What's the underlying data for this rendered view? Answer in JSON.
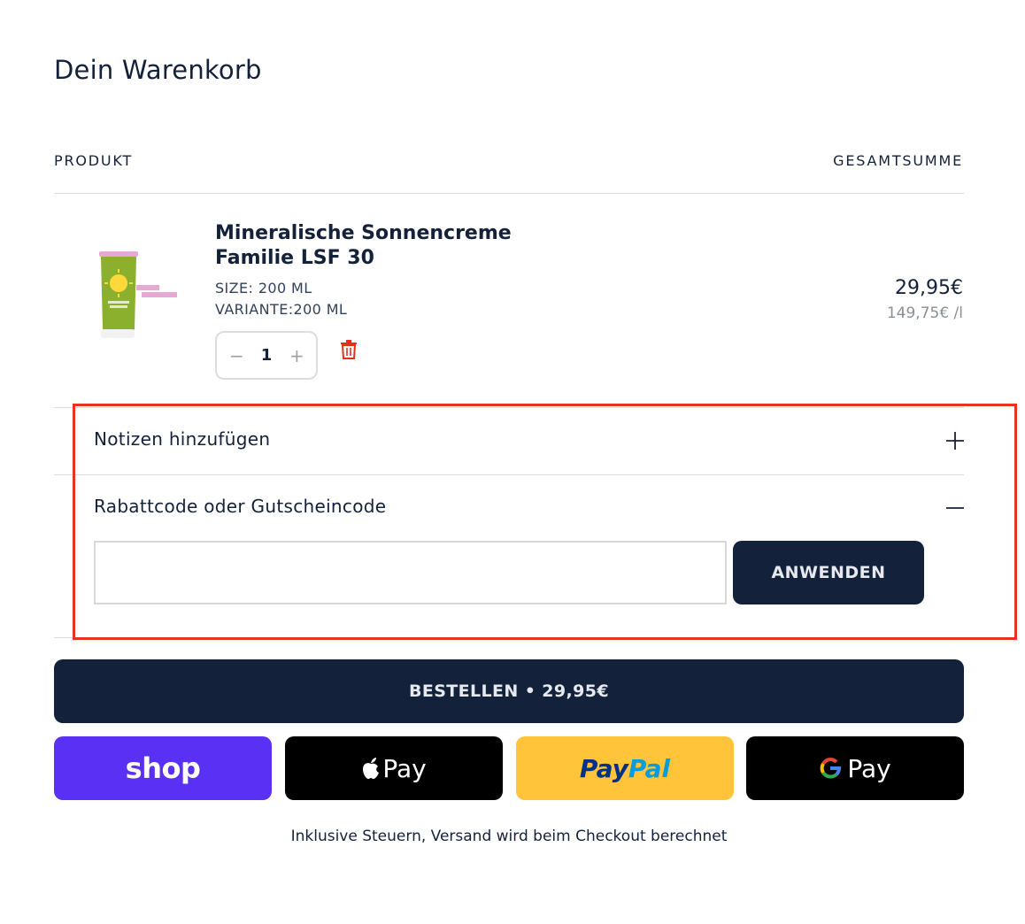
{
  "cart": {
    "title": "Dein Warenkorb",
    "column_product": "PRODUKT",
    "column_total": "GESAMTSUMME"
  },
  "item": {
    "name": "Mineralische Sonnencreme Familie LSF 30",
    "size": "SIZE: 200 ML",
    "variant": "VARIANTE:200 ML",
    "quantity": "1",
    "price": "29,95€",
    "unit_price": "149,75€ /l",
    "remove_icon": "trash-icon"
  },
  "notes": {
    "label": "Notizen hinzufügen",
    "toggle_icon": "plus-icon"
  },
  "discount": {
    "label": "Rabattcode oder Gutscheincode",
    "toggle_icon": "minus-icon",
    "input_value": "",
    "input_placeholder": "",
    "apply_label": "ANWENDEN"
  },
  "checkout": {
    "label": "BESTELLEN • 29,95€"
  },
  "payments": {
    "shop": "shop",
    "apple": "Pay",
    "paypal_part1": "Pay",
    "paypal_part2": "Pal",
    "google": "Pay"
  },
  "footnote": "Inklusive Steuern, Versand wird beim Checkout berechnet",
  "colors": {
    "primary": "#14213a",
    "highlight": "#e8311e",
    "shop": "#5a31f4",
    "paypal": "#ffc439",
    "delete": "#e0301e"
  }
}
